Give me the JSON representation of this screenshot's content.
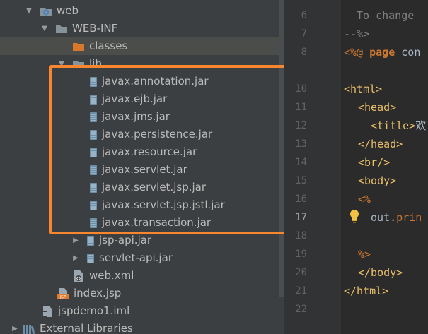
{
  "tree": {
    "items": [
      {
        "label": "web",
        "icon": "web-folder-icon"
      },
      {
        "label": "WEB-INF",
        "icon": "folder-icon"
      },
      {
        "label": "classes",
        "icon": "orange-folder-icon"
      },
      {
        "label": "lib",
        "icon": "folder-icon"
      },
      {
        "label": "javax.annotation.jar",
        "icon": "jar-icon"
      },
      {
        "label": "javax.ejb.jar",
        "icon": "jar-icon"
      },
      {
        "label": "javax.jms.jar",
        "icon": "jar-icon"
      },
      {
        "label": "javax.persistence.jar",
        "icon": "jar-icon"
      },
      {
        "label": "javax.resource.jar",
        "icon": "jar-icon"
      },
      {
        "label": "javax.servlet.jar",
        "icon": "jar-icon"
      },
      {
        "label": "javax.servlet.jsp.jar",
        "icon": "jar-icon"
      },
      {
        "label": "javax.servlet.jsp.jstl.jar",
        "icon": "jar-icon"
      },
      {
        "label": "javax.transaction.jar",
        "icon": "jar-icon"
      },
      {
        "label": "jsp-api.jar",
        "icon": "jar-icon"
      },
      {
        "label": "servlet-api.jar",
        "icon": "jar-icon"
      },
      {
        "label": "web.xml",
        "icon": "xml-file-icon"
      },
      {
        "label": "index.jsp",
        "icon": "jsp-file-icon"
      },
      {
        "label": "jspdemo1.iml",
        "icon": "iml-file-icon"
      },
      {
        "label": "External Libraries",
        "icon": "libraries-icon"
      }
    ]
  },
  "gutter": {
    "lines": [
      "6",
      "7",
      "8",
      "10",
      "11",
      "12",
      "13",
      "14",
      "15",
      "16",
      "17",
      "18",
      "19",
      "20",
      "21",
      "22"
    ]
  },
  "editor": {
    "line0_partial": "To change",
    "line1": "--%>",
    "line2_a": "<%@ ",
    "line2_b": "page",
    "line2_c": " con",
    "line3": "<html>",
    "line4": "<head>",
    "line5_tag": "<title>",
    "line5_rest": "欢",
    "line6": "</head>",
    "line7": "<br/>",
    "line8": "<body>",
    "line9": "<%",
    "line10_a": "out",
    "line10_b": ".",
    "line10_c": "prin",
    "line11": "%>",
    "line12": "</body>",
    "line13": "</html>"
  },
  "colors": {
    "highlight": "#f7862f",
    "tree_bg": "#3c3f41",
    "editor_bg": "#2b2b2b"
  }
}
